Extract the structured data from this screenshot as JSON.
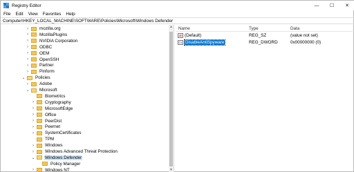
{
  "window": {
    "title": "Registry Editor"
  },
  "controls": {
    "minimize": "—",
    "maximize": "☐",
    "close": "✕"
  },
  "menu": [
    "File",
    "Edit",
    "View",
    "Favorites",
    "Help"
  ],
  "address": "Computer\\HKEY_LOCAL_MACHINE\\SOFTWARE\\Policies\\Microsoft\\Windows Defender",
  "tree": [
    {
      "label": "mozilla.org",
      "chevron": "›",
      "open": false,
      "selected": false
    },
    {
      "label": "MozillaPlugins",
      "chevron": "›",
      "open": false,
      "selected": false
    },
    {
      "label": "NVIDIA Corporation",
      "chevron": "›",
      "open": false,
      "selected": false
    },
    {
      "label": "ODBC",
      "chevron": "›",
      "open": false,
      "selected": false
    },
    {
      "label": "OEM",
      "chevron": "›",
      "open": false,
      "selected": false
    },
    {
      "label": "OpenSSH",
      "chevron": "›",
      "open": false,
      "selected": false
    },
    {
      "label": "Partner",
      "chevron": "›",
      "open": false,
      "selected": false
    },
    {
      "label": "Pinform",
      "chevron": "›",
      "open": false,
      "selected": false
    },
    {
      "label": "Policies",
      "chevron": "⌄",
      "open": true,
      "selected": false
    },
    {
      "label": "Adobe",
      "chevron": "›",
      "open": false,
      "selected": false
    },
    {
      "label": "Microsoft",
      "chevron": "⌄",
      "open": true,
      "selected": false
    },
    {
      "label": "Biometrics",
      "chevron": "",
      "open": false,
      "selected": false
    },
    {
      "label": "Cryptography",
      "chevron": "›",
      "open": false,
      "selected": false
    },
    {
      "label": "MicrosoftEdge",
      "chevron": "›",
      "open": false,
      "selected": false
    },
    {
      "label": "Office",
      "chevron": "›",
      "open": false,
      "selected": false
    },
    {
      "label": "PeerDist",
      "chevron": "›",
      "open": false,
      "selected": false
    },
    {
      "label": "Peernet",
      "chevron": "›",
      "open": false,
      "selected": false
    },
    {
      "label": "SystemCertificates",
      "chevron": "›",
      "open": false,
      "selected": false
    },
    {
      "label": "TPM",
      "chevron": "",
      "open": false,
      "selected": false
    },
    {
      "label": "Windows",
      "chevron": "›",
      "open": false,
      "selected": false
    },
    {
      "label": "Windows Advanced Threat Protection",
      "chevron": "›",
      "open": false,
      "selected": false
    },
    {
      "label": "Windows Defender",
      "chevron": "⌄",
      "open": true,
      "selected": true
    },
    {
      "label": "Policy Manager",
      "chevron": "",
      "open": false,
      "selected": false
    },
    {
      "label": "Windows NT",
      "chevron": "›",
      "open": false,
      "selected": false
    }
  ],
  "list": {
    "headers": {
      "name": "Name",
      "type": "Type",
      "data": "Data"
    },
    "rows": [
      {
        "icon": "string-value-icon",
        "glyph": "ab",
        "name": "(Default)",
        "type": "REG_SZ",
        "data": "(value not set)",
        "selected": false
      },
      {
        "icon": "dword-value-icon",
        "glyph": "01",
        "name": "DisableAntiSpyware",
        "type": "REG_DWORD",
        "data": "0x00000000 (0)",
        "selected": true
      }
    ]
  },
  "colors": {
    "folder": "#f0c75a",
    "selection": "#0078d7",
    "tree_selection": "#cce4f7"
  }
}
